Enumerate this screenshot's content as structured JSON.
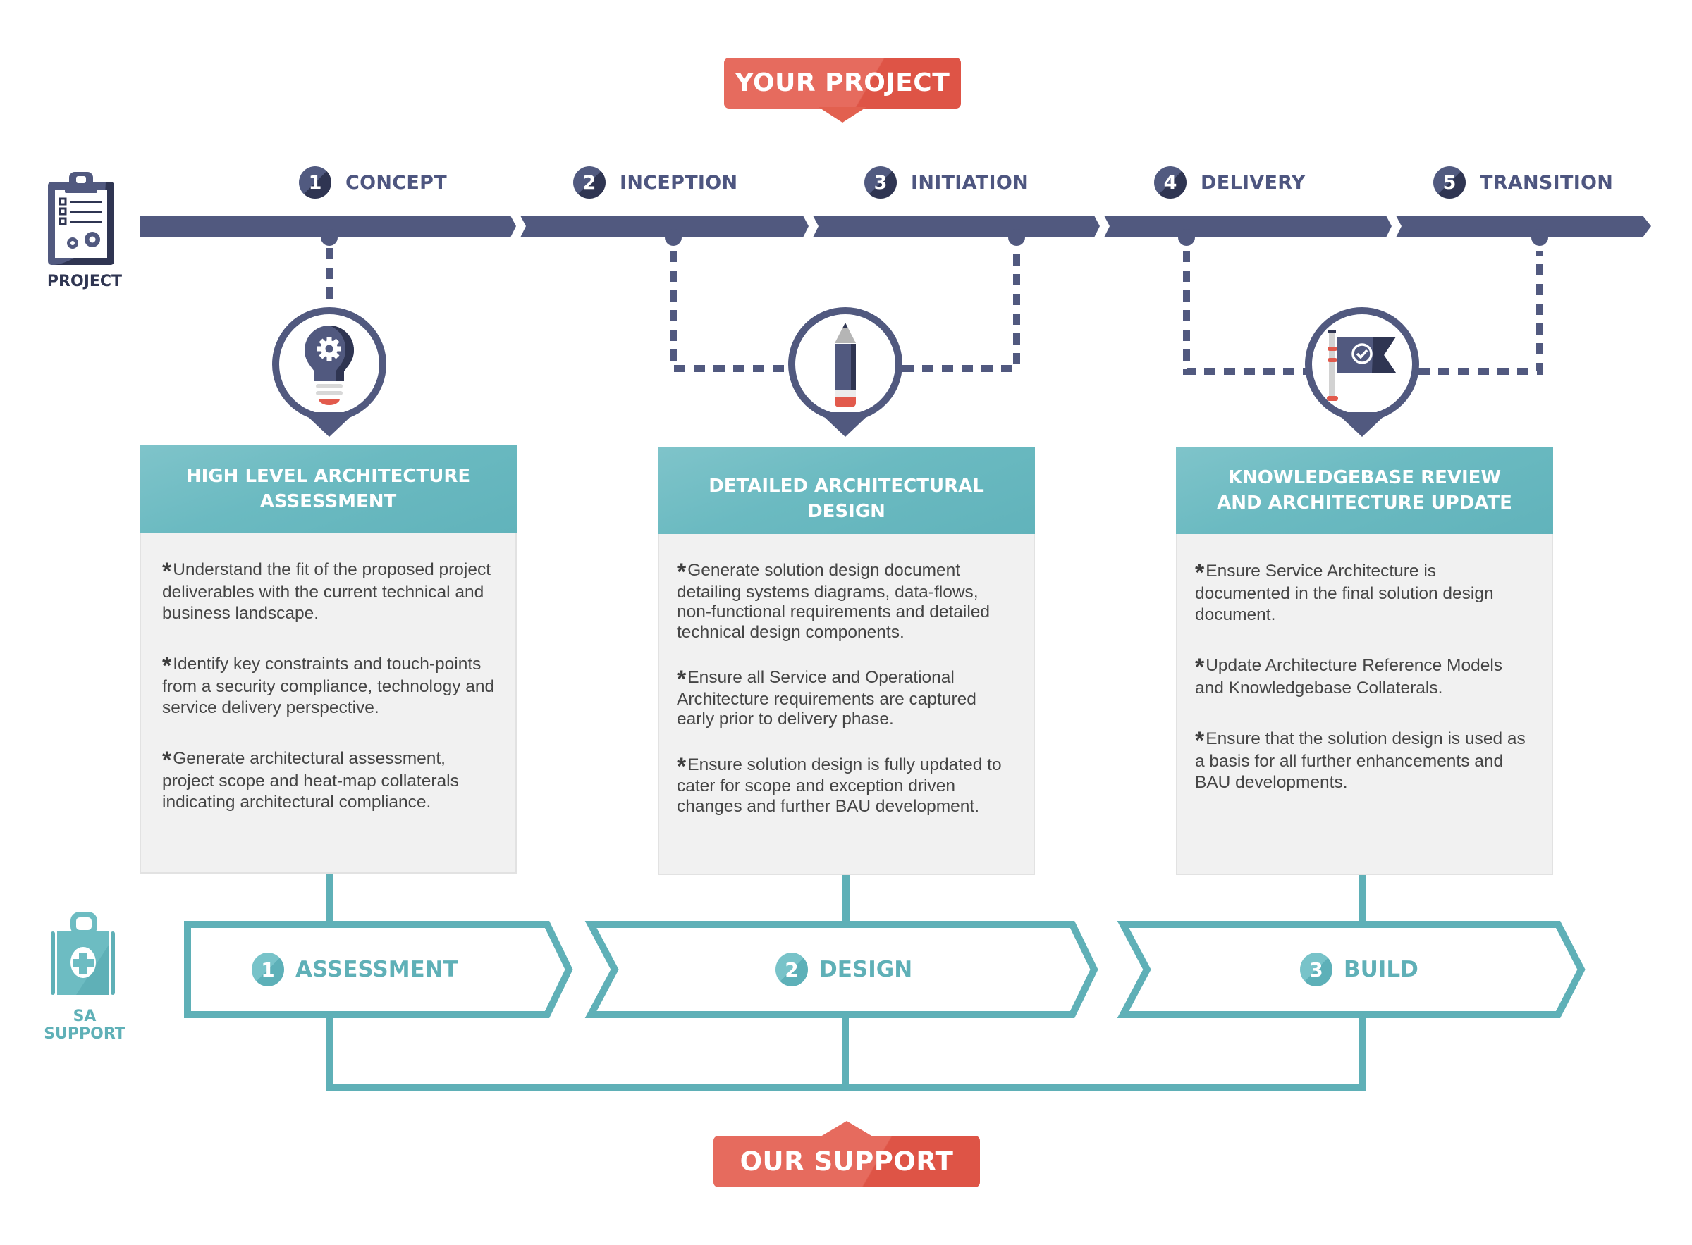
{
  "colors": {
    "navy": "#51597f",
    "navy_dark": "#2f3552",
    "teal": "#5fb0b7",
    "teal_light": "#78c3c9",
    "coral": "#e66b5e",
    "coral_dark": "#de5446",
    "card_bg": "#f1f1f1",
    "text": "#454545"
  },
  "top_banner": {
    "label": "YOUR PROJECT"
  },
  "bottom_banner": {
    "label": "OUR SUPPORT"
  },
  "project_side": {
    "label": "PROJECT",
    "icon": "clipboard-gears-icon"
  },
  "support_side": {
    "label": "SA SUPPORT",
    "icon": "first-aid-kit-icon"
  },
  "phases": [
    {
      "number": "1",
      "label": "CONCEPT"
    },
    {
      "number": "2",
      "label": "INCEPTION"
    },
    {
      "number": "3",
      "label": "INITIATION"
    },
    {
      "number": "4",
      "label": "DELIVERY"
    },
    {
      "number": "5",
      "label": "TRANSITION"
    }
  ],
  "cards": [
    {
      "icon": "lightbulb-gear-icon",
      "title": "HIGH LEVEL ARCHITECTURE ASSESSMENT",
      "bullet_symbol": "*",
      "bullets": [
        "Understand the fit of the proposed project deliverables with the current technical and business landscape.",
        "Identify key constraints and touch-points from a security compliance, technology and service delivery perspective.",
        "Generate architectural assessment, project scope and heat-map collaterals indicating architectural compliance."
      ]
    },
    {
      "icon": "pencil-icon",
      "title": "DETAILED ARCHITECTURAL DESIGN",
      "bullet_symbol": "*",
      "bullets": [
        "Generate  solution design document detailing systems diagrams, data-flows, non-functional requirements and detailed technical design components.",
        "Ensure all Service and Operational Architecture requirements are captured early prior to delivery phase.",
        "Ensure solution design is fully updated to cater for scope and exception driven changes and further BAU development."
      ]
    },
    {
      "icon": "flag-check-icon",
      "title": "KNOWLEDGEBASE REVIEW AND ARCHITECTURE UPDATE",
      "bullet_symbol": "*",
      "bullets": [
        "Ensure Service Architecture is documented in the final solution design document.",
        "Update Architecture Reference Models and Knowledgebase Collaterals.",
        "Ensure that the solution design is used as a basis for all further enhancements and BAU developments."
      ]
    }
  ],
  "support_steps": [
    {
      "number": "1",
      "label": "ASSESSMENT"
    },
    {
      "number": "2",
      "label": "DESIGN"
    },
    {
      "number": "3",
      "label": "BUILD"
    }
  ]
}
